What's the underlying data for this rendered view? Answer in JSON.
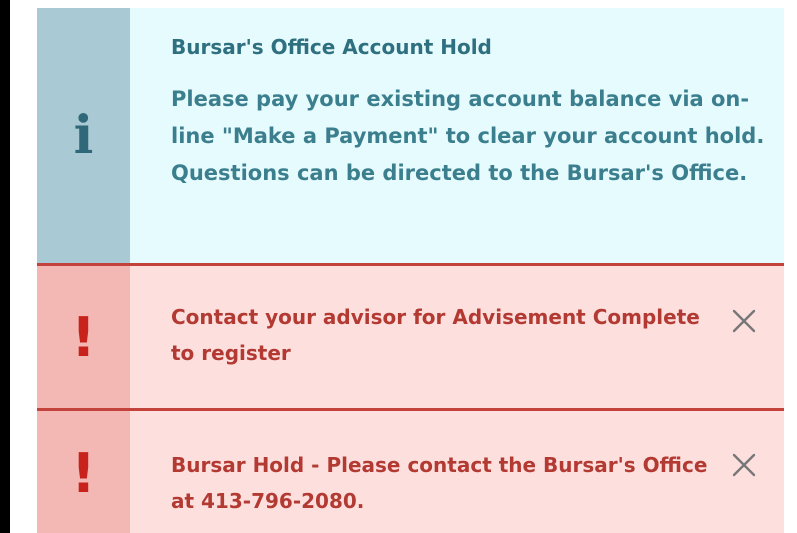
{
  "alerts": {
    "info": {
      "icon": "info-icon",
      "glyph": "i",
      "title": "Bursar's Office Account Hold",
      "message": "Please pay your existing account balance via on-line \"Make a Payment\" to clear your account hold. Questions can be directed to the Bursar's Office."
    },
    "advisement": {
      "icon": "exclamation-icon",
      "glyph": "!",
      "message": "Contact your advisor for Advisement Complete to register",
      "close_icon": "close-icon"
    },
    "bursar_hold": {
      "icon": "exclamation-icon",
      "glyph": "!",
      "message": "Bursar Hold - Please contact the Bursar's Office at 413-796-2080.",
      "close_icon": "close-icon"
    }
  },
  "colors": {
    "info_background": "#e6fbfd",
    "info_icon_column": "#a9c9d5",
    "info_text": "#3b7f8f",
    "danger_background": "#fde0de",
    "danger_icon_column": "#f4b8b4",
    "danger_border": "#c4423c",
    "danger_text": "#b33a33"
  }
}
